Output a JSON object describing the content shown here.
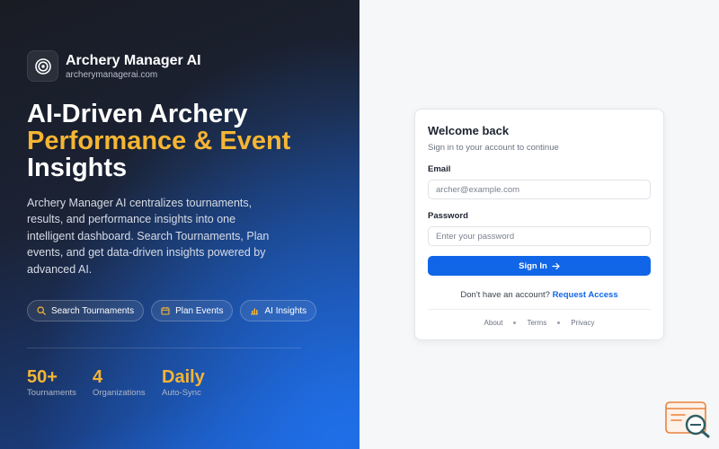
{
  "brand": {
    "name": "Archery Manager AI",
    "domain": "archerymanagerai.com",
    "logo_icon": "target-icon"
  },
  "hero": {
    "headline_line1": "AI-Driven Archery",
    "headline_line2": "Performance & Event",
    "headline_line3": "Insights",
    "description": "Archery Manager AI centralizes tournaments, results, and performance insights into one intelligent dashboard. Search Tournaments, Plan events, and get data-driven insights powered by advanced AI."
  },
  "chips": [
    {
      "label": "Search Tournaments",
      "icon": "search-icon"
    },
    {
      "label": "Plan Events",
      "icon": "calendar-icon"
    },
    {
      "label": "AI Insights",
      "icon": "bar-chart-icon"
    }
  ],
  "stats": [
    {
      "value": "50+",
      "label": "Tournaments"
    },
    {
      "value": "4",
      "label": "Organizations"
    },
    {
      "value": "Daily",
      "label": "Auto-Sync"
    }
  ],
  "login": {
    "title": "Welcome back",
    "subtitle": "Sign in to your account to continue",
    "email_label": "Email",
    "email_placeholder": "archer@example.com",
    "password_label": "Password",
    "password_placeholder": "Enter your password",
    "signin_label": "Sign In",
    "no_account_text": "Don't have an account?",
    "request_access_label": "Request Access"
  },
  "footer": {
    "links": [
      "About",
      "Terms",
      "Privacy"
    ]
  },
  "colors": {
    "accent_yellow": "#f5b534",
    "primary_blue": "#1166e8"
  }
}
